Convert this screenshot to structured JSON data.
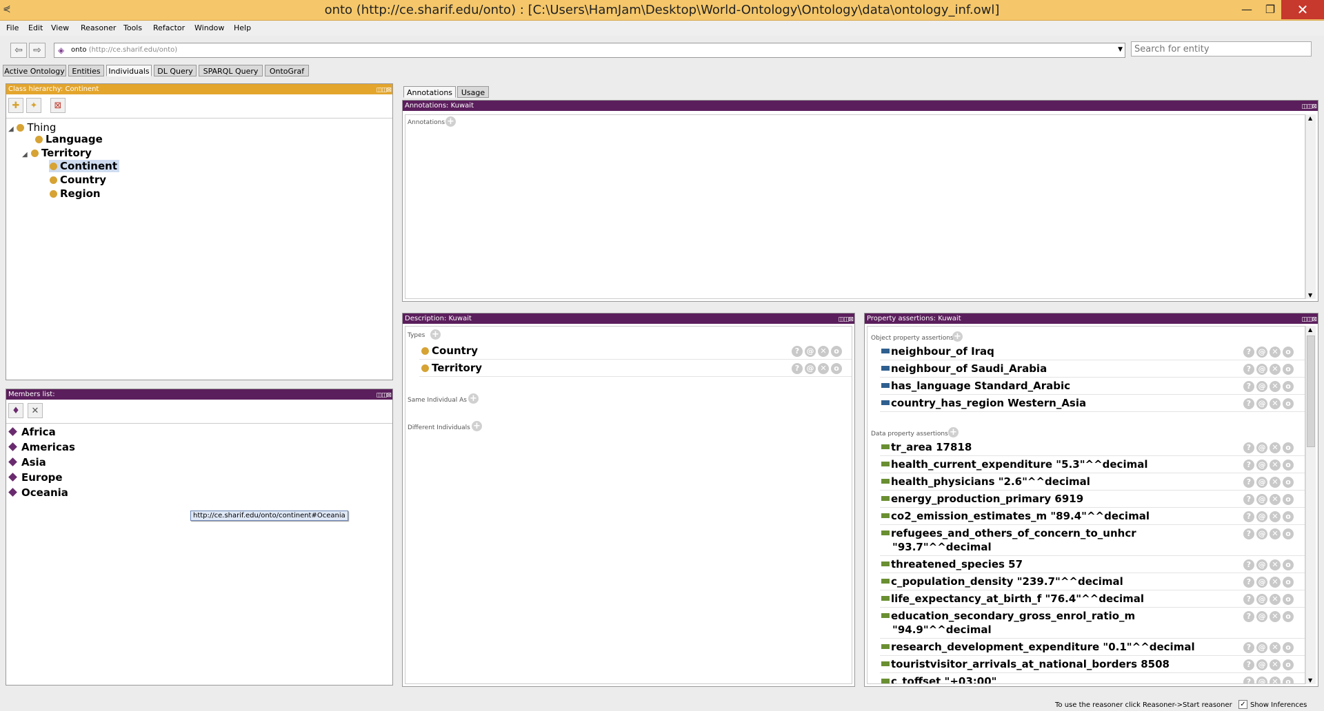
{
  "window": {
    "title": "onto (http://ce.sharif.edu/onto)  : [C:\\Users\\HamJam\\Desktop\\World-Ontology\\Ontology\\data\\ontology_inf.owl]",
    "minimize": "—",
    "maximize": "❐",
    "close": "✕"
  },
  "menu": [
    "File",
    "Edit",
    "View",
    "Reasoner",
    "Tools",
    "Refactor",
    "Window",
    "Help"
  ],
  "address": {
    "name": "onto",
    "iri": "(http://ce.sharif.edu/onto)"
  },
  "search": {
    "placeholder": "Search for entity"
  },
  "tabs": [
    "Active Ontology",
    "Entities",
    "Individuals",
    "DL Query",
    "SPARQL Query",
    "OntoGraf"
  ],
  "class_hierarchy": {
    "title": "Class hierarchy: Continent",
    "nodes": [
      "Thing",
      "Language",
      "Territory",
      "Continent",
      "Country",
      "Region"
    ]
  },
  "members": {
    "title": "Members list:",
    "items": [
      "Africa",
      "Americas",
      "Asia",
      "Europe",
      "Oceania"
    ],
    "tooltip": "http://ce.sharif.edu/onto/continent#Oceania"
  },
  "annotations": {
    "tabs": [
      "Annotations",
      "Usage"
    ],
    "title": "Annotations: Kuwait",
    "label": "Annotations"
  },
  "description": {
    "title": "Description: Kuwait",
    "types_label": "Types",
    "types": [
      "Country",
      "Territory"
    ],
    "same_label": "Same Individual As",
    "different_label": "Different Individuals"
  },
  "properties": {
    "title": "Property assertions: Kuwait",
    "object_label": "Object property assertions",
    "object": [
      "neighbour_of  Iraq",
      "neighbour_of  Saudi_Arabia",
      "has_language  Standard_Arabic",
      "country_has_region  Western_Asia"
    ],
    "data_label": "Data property assertions",
    "data": [
      "tr_area  17818",
      "health_current_expenditure  \"5.3\"^^decimal",
      "health_physicians  \"2.6\"^^decimal",
      "energy_production_primary  6919",
      "co2_emission_estimates_m  \"89.4\"^^decimal",
      "refugees_and_others_of_concern_to_unhcr",
      "\"93.7\"^^decimal",
      "threatened_species  57",
      "c_population_density  \"239.7\"^^decimal",
      "life_expectancy_at_birth_f  \"76.4\"^^decimal",
      "education_secondary_gross_enrol_ratio_m",
      "\"94.9\"^^decimal",
      "research_development_expenditure  \"0.1\"^^decimal",
      "touristvisitor_arrivals_at_national_borders  8508",
      "c_toffset  \"+03:00\""
    ]
  },
  "status": {
    "message": "To use the reasoner click Reasoner->Start reasoner",
    "show_inferences": "Show Inferences"
  }
}
